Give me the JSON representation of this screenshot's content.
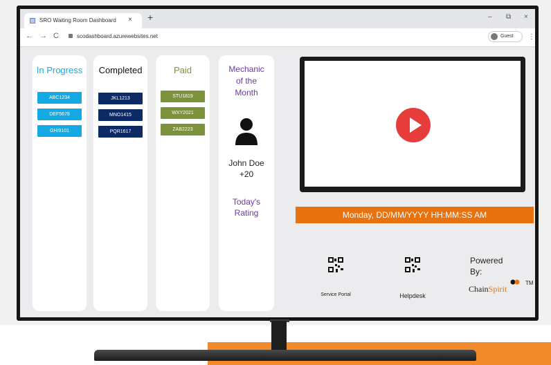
{
  "browser": {
    "tab_title": "SRO Waiting Room Dashboard",
    "tab_close": "×",
    "new_tab": "+",
    "back": "←",
    "forward": "→",
    "reload": "C",
    "url": "scodashboard.azurewebsites.net",
    "profile": "Guest",
    "menu": "⋮",
    "minimize": "–",
    "maximize": "⧉",
    "close": "×"
  },
  "columns": {
    "in_progress": {
      "title": "In Progress",
      "items": [
        "ABC1234",
        "DEF5678",
        "GHI9101"
      ]
    },
    "completed": {
      "title": "Completed",
      "items": [
        "JKL1213",
        "MNO1415",
        "PQR1617"
      ]
    },
    "paid": {
      "title": "Paid",
      "items": [
        "STU1819",
        "WXY2021",
        "ZAB2223"
      ]
    }
  },
  "mechanic": {
    "heading_lines": [
      "Mechanic",
      "of the",
      "Month"
    ],
    "name": "John Doe",
    "points": "+20",
    "rating_lines": [
      "Today's",
      "Rating"
    ],
    "icon": "person-icon"
  },
  "video": {
    "icon": "play-icon"
  },
  "datetime": "Monday, DD/MM/YYYY  HH:MM:SS AM",
  "qr": {
    "service_label": "Service Portal",
    "helpdesk_label": "Helpdesk",
    "icon": "qr-code-icon"
  },
  "powered": {
    "line1": "Powered",
    "line2": "By:",
    "brand_a": "Chain",
    "brand_b": "Spirit",
    "tm": "TM"
  },
  "colors": {
    "in_progress": "#15a9e3",
    "completed": "#0c2a63",
    "paid": "#7b913a",
    "mechanic_text": "#6b3aa0",
    "accent_orange": "#e8720f",
    "play": "#e63c3c"
  }
}
